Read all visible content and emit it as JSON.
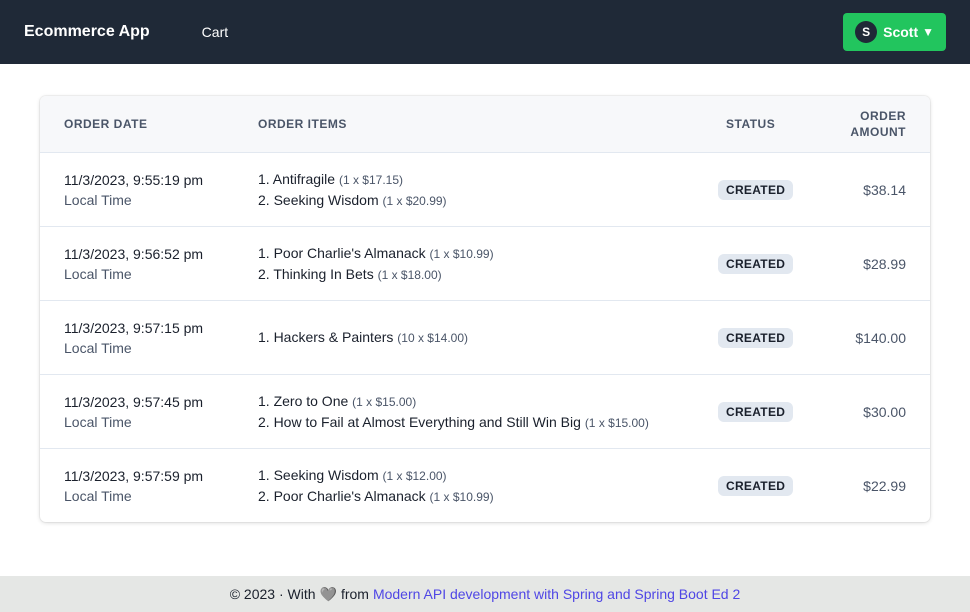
{
  "navbar": {
    "brand": "Ecommerce App",
    "cart_link": "Cart",
    "user": {
      "initial": "S",
      "name": "Scott",
      "caret": "▼"
    }
  },
  "table": {
    "headers": {
      "date": "ORDER DATE",
      "items": "ORDER ITEMS",
      "status": "STATUS",
      "amount_line1": "ORDER",
      "amount_line2": "AMOUNT"
    },
    "rows": [
      {
        "date": "11/3/2023, 9:55:19 pm",
        "date_sub": "Local Time",
        "items": [
          {
            "name": "1. Antifragile",
            "qty": "(1 x $17.15)"
          },
          {
            "name": "2. Seeking Wisdom",
            "qty": "(1 x $20.99)"
          }
        ],
        "status": "CREATED",
        "amount": "$38.14"
      },
      {
        "date": "11/3/2023, 9:56:52 pm",
        "date_sub": "Local Time",
        "items": [
          {
            "name": "1. Poor Charlie's Almanack",
            "qty": "(1 x $10.99)"
          },
          {
            "name": "2. Thinking In Bets",
            "qty": "(1 x $18.00)"
          }
        ],
        "status": "CREATED",
        "amount": "$28.99"
      },
      {
        "date": "11/3/2023, 9:57:15 pm",
        "date_sub": "Local Time",
        "items": [
          {
            "name": "1. Hackers & Painters",
            "qty": "(10 x $14.00)"
          }
        ],
        "status": "CREATED",
        "amount": "$140.00"
      },
      {
        "date": "11/3/2023, 9:57:45 pm",
        "date_sub": "Local Time",
        "items": [
          {
            "name": "1. Zero to One",
            "qty": "(1 x $15.00)"
          },
          {
            "name": "2. How to Fail at Almost Everything and Still Win Big",
            "qty": "(1 x $15.00)"
          }
        ],
        "status": "CREATED",
        "amount": "$30.00"
      },
      {
        "date": "11/3/2023, 9:57:59 pm",
        "date_sub": "Local Time",
        "items": [
          {
            "name": "1. Seeking Wisdom",
            "qty": "(1 x $12.00)"
          },
          {
            "name": "2. Poor Charlie's Almanack",
            "qty": "(1 x $10.99)"
          }
        ],
        "status": "CREATED",
        "amount": "$22.99"
      }
    ]
  },
  "footer": {
    "prefix": "© 2023 · With",
    "heart": "🩶",
    "middle": "from",
    "link": "Modern API development with Spring and Spring Boot Ed 2"
  },
  "colors": {
    "navbar_bg": "#1f2937",
    "user_button": "#22c55e",
    "link": "#4f46e5",
    "badge_bg": "#e2e8f0"
  }
}
